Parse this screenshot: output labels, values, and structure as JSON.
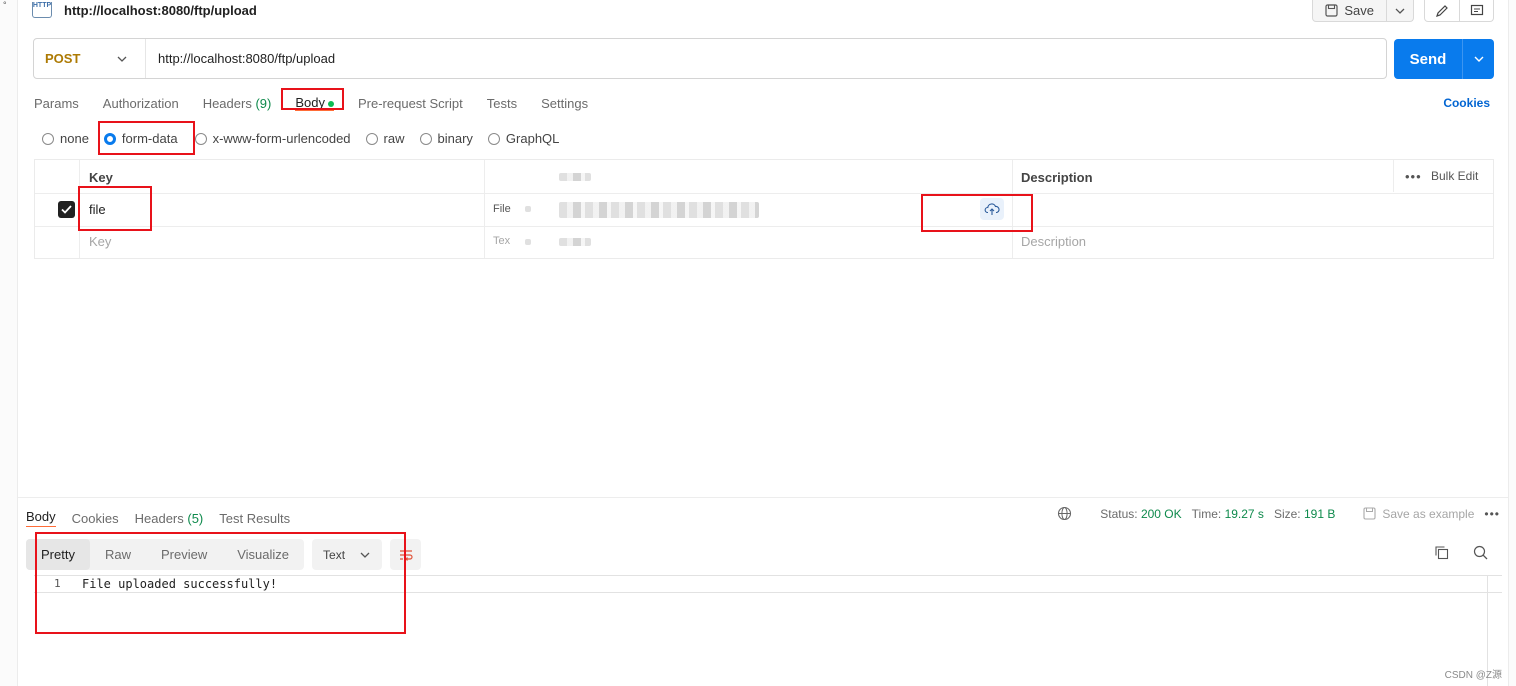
{
  "request": {
    "badge": "HTTP",
    "title": "http://localhost:8080/ftp/upload",
    "save_label": "Save"
  },
  "url_bar": {
    "method": "POST",
    "url": "http://localhost:8080/ftp/upload",
    "send_label": "Send"
  },
  "request_tabs": {
    "params": "Params",
    "authorization": "Authorization",
    "headers": "Headers",
    "headers_count": "(9)",
    "body": "Body",
    "pre_request": "Pre-request Script",
    "tests": "Tests",
    "settings": "Settings",
    "cookies": "Cookies"
  },
  "body_modes": {
    "none": "none",
    "form_data": "form-data",
    "urlencoded": "x-www-form-urlencoded",
    "raw": "raw",
    "binary": "binary",
    "graphql": "GraphQL",
    "selected": "form-data"
  },
  "form_table": {
    "headers": {
      "key": "Key",
      "description": "Description",
      "bulk_edit": "Bulk Edit"
    },
    "rows": [
      {
        "checked": true,
        "key": "file",
        "type": "File"
      }
    ],
    "empty_row": {
      "key_placeholder": "Key",
      "type": "Tex",
      "description_placeholder": "Description"
    }
  },
  "response": {
    "tabs": {
      "body": "Body",
      "cookies": "Cookies",
      "headers": "Headers",
      "headers_count": "(5)",
      "test_results": "Test Results"
    },
    "status_label": "Status:",
    "status_value": "200 OK",
    "time_label": "Time:",
    "time_value": "19.27 s",
    "size_label": "Size:",
    "size_value": "191 B",
    "save_example": "Save as example",
    "view_options": {
      "pretty": "Pretty",
      "raw": "Raw",
      "preview": "Preview",
      "visualize": "Visualize"
    },
    "format": "Text",
    "lines": [
      {
        "no": "1",
        "text": "File uploaded successfully!"
      }
    ]
  },
  "watermark": "CSDN @Z源",
  "colors": {
    "accent": "#097bed",
    "method": "#ad7a03",
    "status_ok": "#0e8a4c",
    "annotation": "#e8121a",
    "active_tab_underline": "#ff6c37"
  }
}
